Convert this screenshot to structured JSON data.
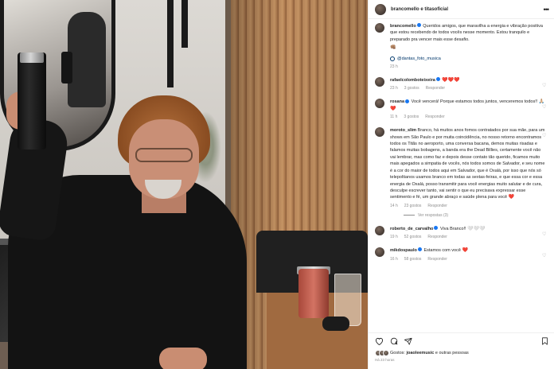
{
  "header": {
    "names": "brancomello e titasoficial",
    "more_glyph": "•••"
  },
  "caption": {
    "username": "brancomello",
    "text": "Queridos amigos, que maravilha a energia e vibração positiva que estou recebendo de todos vocês nesse momento. Estou tranquilo e preparado pra vencer mais esse desafio.",
    "emoji": "👊🏽",
    "tag": "@dantas_foto_musica",
    "time": "23 h"
  },
  "comments": [
    {
      "username": "rafaelcolomboteixeira",
      "verified": true,
      "text": "",
      "hearts": "❤️❤️❤️",
      "time": "23 h",
      "likes": "3 gostos",
      "reply": "Responder"
    },
    {
      "username": "rosana",
      "verified": true,
      "text": "Você vencerá! Porque estamos todos juntos, venceremos todos!!",
      "hearts": "🙏🏼❤️",
      "time": "11 h",
      "likes": "3 gostos",
      "reply": "Responder"
    },
    {
      "username": "moroto_slim",
      "verified": false,
      "text": "Branco, há muitos anos fomos contratados por sua mãe, para um shows em São Paulo e por muita coincidência, no nosso retorno encontramos todos os Titãs no aeroporto, uma conversa bacana, demos muitas risadas e falamos muitas bobagens, a banda era the Dead Billies, certamente você não vai lembrar, mas como faz e depois desse contato tão querido, ficamos muito mais apegados a simpatia de vocês, nós todos somos de Salvador, e seu nome é a cor do maior de todos aqui em Salvador, que é Oxalá, por isso que nós só telepoltianos usamos branco em todas as sextas-feiras, e que essa cor e essa energia de Oxalá, posso transmitir para você energias muito salutar e de cura, desculpe escrever tanto, vai sentir o que eu precisava expressar esse sentimento e fé, um grande abraço e saúde plena para você",
      "hearts": "❤️",
      "time": "14 h",
      "likes": "23 gostos",
      "reply": "Responder",
      "more_replies": "Ver respostas (3)"
    },
    {
      "username": "roberto_de_carvalho",
      "verified": true,
      "text": "Viva Branco!!",
      "hearts": "🤍🤍🤍",
      "time": "19 h",
      "likes": "52 gostos",
      "reply": "Responder"
    },
    {
      "username": "mikdospaulo",
      "verified": true,
      "text": "Estamos com você",
      "hearts": "❤️",
      "time": "16 h",
      "likes": "58 gostos",
      "reply": "Responder"
    }
  ],
  "actions": {
    "like_icon": "heart-outline-icon",
    "comment_icon": "comment-icon",
    "share_icon": "share-icon",
    "save_icon": "bookmark-icon",
    "likes_prefix": "Gostos:",
    "likes_user": "joaoleemusic",
    "likes_suffix": "e outras pessoas",
    "time_ago": "Há 23 horas"
  },
  "colors": {
    "verified": "#1877f2",
    "link": "#00376b",
    "muted": "#8e8e8e",
    "heart": "#ed4956"
  }
}
